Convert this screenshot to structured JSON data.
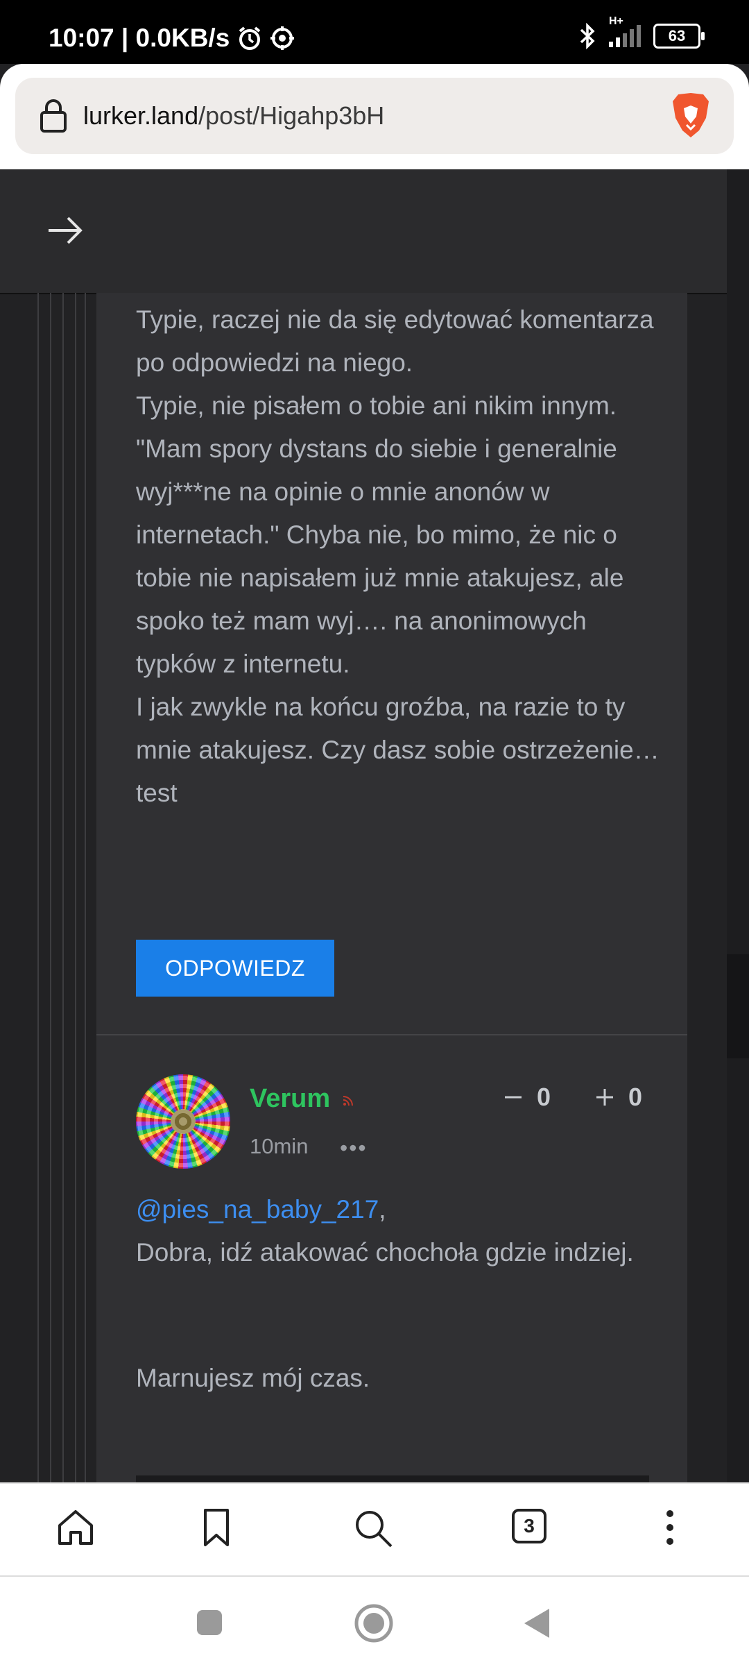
{
  "status_bar": {
    "time_speed": "10:07 | 0.0KB/s",
    "network": "H+",
    "battery": "63"
  },
  "browser": {
    "url_domain": "lurker.land",
    "url_path": "/post/Higahp3bH",
    "tabs_count": "3"
  },
  "comment_previous": {
    "text": "Typie, raczej nie da się edytować komentarza po odpowiedzi na niego.\nTypie, nie pisałem o tobie ani nikim innym.\n\"Mam spory dystans do siebie i generalnie wyj***ne na opinie o mnie anonów w internetach.\" Chyba nie, bo mimo, że nic o tobie nie napisałem już mnie atakujesz, ale spoko też mam wyj…. na anonimowych typków z internetu.\nI jak zwykle na końcu groźba, na razie to ty mnie atakujesz. Czy dasz sobie ostrzeżenie…test",
    "reply_label": "ODPOWIEDZ"
  },
  "comment": {
    "username": "Verum",
    "time": "10min",
    "more": "•••",
    "downvotes": "0",
    "upvotes": "0",
    "mention": "@pies_na_baby_217",
    "mention_suffix": ",",
    "text": "Dobra, idź atakować chochoła gdzie indziej.",
    "text2": "Marnujesz mój czas."
  },
  "colors": {
    "accent": "#1a7fe8",
    "username": "#2ec45f",
    "link": "#3d8ef0",
    "card_bg": "#303033",
    "page_bg": "#222224"
  },
  "icons": [
    "clock-icon",
    "alarm-icon",
    "target-icon",
    "bluetooth-icon",
    "signal-icon",
    "battery-icon",
    "lock-icon",
    "brave-lion-icon",
    "arrow-right-icon",
    "rss-icon",
    "minus-icon",
    "plus-icon",
    "home-icon",
    "bookmark-icon",
    "search-icon",
    "tabs-icon",
    "more-vertical-icon",
    "recent-apps-icon",
    "home-nav-icon",
    "back-nav-icon"
  ]
}
